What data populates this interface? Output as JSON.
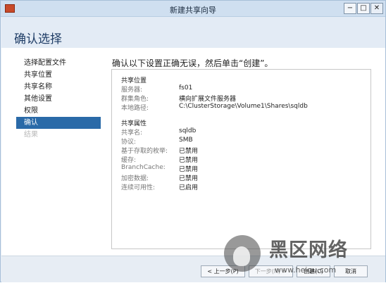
{
  "window": {
    "title": "新建共享向导",
    "header": "确认选择"
  },
  "nav": [
    {
      "label": "选择配置文件",
      "state": "normal"
    },
    {
      "label": "共享位置",
      "state": "normal"
    },
    {
      "label": "共享名称",
      "state": "normal"
    },
    {
      "label": "其他设置",
      "state": "normal"
    },
    {
      "label": "权限",
      "state": "normal"
    },
    {
      "label": "确认",
      "state": "active"
    },
    {
      "label": "结果",
      "state": "disabled"
    }
  ],
  "prompt": "确认以下设置正确无误，然后单击“创建”。",
  "summary": {
    "location": {
      "title": "共享位置",
      "rows": [
        {
          "label": "服务器:",
          "value": "fs01"
        },
        {
          "label": "群集角色:",
          "value": "横向扩展文件服务器"
        },
        {
          "label": "本地路径:",
          "value": "C:\\ClusterStorage\\Volume1\\Shares\\sqldb"
        }
      ]
    },
    "properties": {
      "title": "共享属性",
      "rows": [
        {
          "label": "共享名:",
          "value": "sqldb"
        },
        {
          "label": "协议:",
          "value": "SMB"
        },
        {
          "label": "基于存取的枚举:",
          "value": "已禁用"
        },
        {
          "label": "缓存:",
          "value": "已禁用"
        },
        {
          "label": "BranchCache:",
          "value": "已禁用"
        },
        {
          "label": "加密数据:",
          "value": "已禁用"
        },
        {
          "label": "连续可用性:",
          "value": "已启用"
        }
      ]
    }
  },
  "buttons": {
    "previous": "< 上一步(P)",
    "next": "下一步(N) >",
    "create": "创建(C)",
    "cancel": "取消"
  },
  "watermark": {
    "title": "黑区网络",
    "url": "www.heiqu.com"
  },
  "colors": {
    "accent": "#2a6aa8",
    "header_text": "#1f3d66"
  }
}
